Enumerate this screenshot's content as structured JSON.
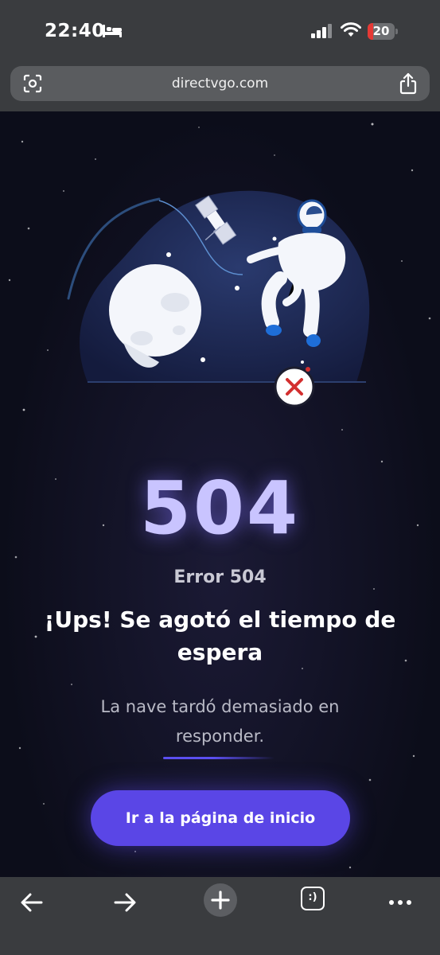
{
  "status_bar": {
    "time": "22:40",
    "battery_level": "20",
    "battery_color": "#e53935"
  },
  "browser": {
    "url": "directvgo.com"
  },
  "page": {
    "code": "504",
    "error_label": "Error 504",
    "headline": "¡Ups! Se agotó el tiempo de espera",
    "message": "La nave tardó demasiado en responder.",
    "button_label": "Ir a la página de inicio",
    "accent_color": "#5a46e6"
  },
  "toolbar": {
    "items": [
      "back-icon",
      "forward-icon",
      "new-tab-icon",
      "tabs-icon",
      "more-icon"
    ],
    "tabs_glyph": ":)"
  }
}
